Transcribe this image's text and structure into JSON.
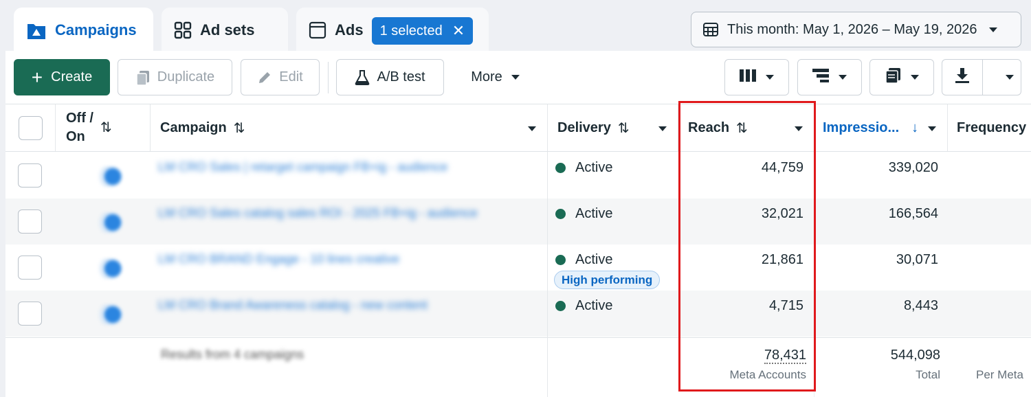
{
  "tabs": {
    "campaigns": "Campaigns",
    "adsets": "Ad sets",
    "ads": "Ads",
    "selected_chip": "1 selected"
  },
  "date_range": "This month: May 1, 2026 – May 19, 2026",
  "toolbar": {
    "create": "Create",
    "duplicate": "Duplicate",
    "edit": "Edit",
    "ab_test": "A/B test",
    "more": "More"
  },
  "columns": {
    "off_on_line1": "Off /",
    "off_on_line2": "On",
    "campaign": "Campaign",
    "delivery": "Delivery",
    "reach": "Reach",
    "impressions": "Impressio...",
    "frequency": "Frequency"
  },
  "rows": [
    {
      "campaign": "LM CRO Sales | retarget campaign FB+ig - audience",
      "delivery": "Active",
      "badge": "",
      "reach": "44,759",
      "impressions": "339,020"
    },
    {
      "campaign": "LM CRO Sales catalog sales ROI - 2025 FB+ig - audience",
      "delivery": "Active",
      "badge": "",
      "reach": "32,021",
      "impressions": "166,564"
    },
    {
      "campaign": "LM CRO BRAND Engage - 10 lines creative",
      "delivery": "Active",
      "badge": "High performing",
      "reach": "21,861",
      "impressions": "30,071"
    },
    {
      "campaign": "LM CRO Brand Awareness catalog - new content",
      "delivery": "Active",
      "badge": "",
      "reach": "4,715",
      "impressions": "8,443"
    }
  ],
  "summary": {
    "label": "Results from 4 campaigns",
    "reach": "78,431",
    "reach_sub": "Meta Accounts",
    "impressions": "544,098",
    "impressions_sub": "Total",
    "frequency_sub": "Per Meta"
  },
  "colors": {
    "brand_blue": "#0a66c2",
    "create_green": "#1a6b54",
    "active_dot": "#1a6b54",
    "highlight_red": "#e0191c"
  }
}
